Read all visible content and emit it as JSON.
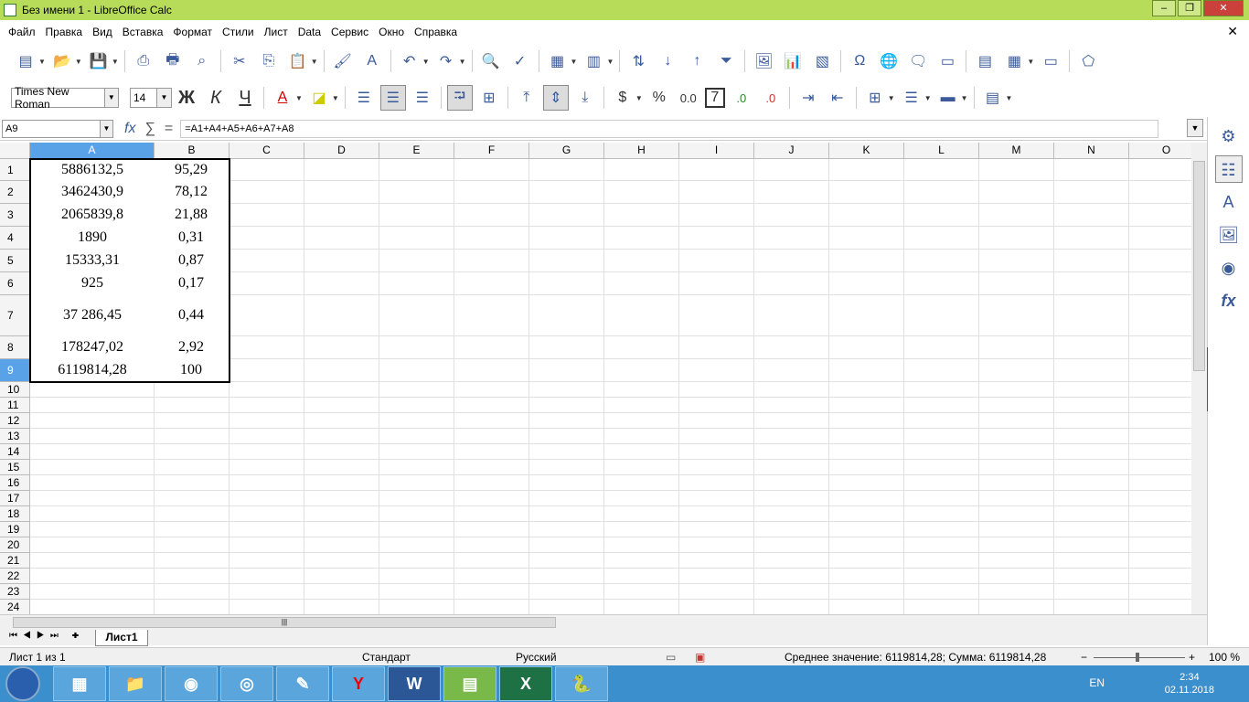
{
  "window": {
    "title": "Без имени 1 - LibreOffice Calc",
    "min": "–",
    "max": "❐",
    "close": "✕"
  },
  "menu": [
    "Файл",
    "Правка",
    "Вид",
    "Вставка",
    "Формат",
    "Стили",
    "Лист",
    "Data",
    "Сервис",
    "Окно",
    "Справка"
  ],
  "menu_close": "✕",
  "format": {
    "font": "Times New Roman",
    "size": "14",
    "bold": "Ж",
    "italic": "К",
    "underline": "Ч",
    "currency": "$",
    "percent": "%",
    "number": "0.0",
    "decimal_add": ".0",
    "decimal_remove": ".0"
  },
  "formula_bar": {
    "cell_ref": "A9",
    "fx": "fx",
    "sigma": "∑",
    "equals": "=",
    "formula": "=A1+A4+A5+A6+A7+A8"
  },
  "columns": [
    "A",
    "B",
    "C",
    "D",
    "E",
    "F",
    "G",
    "H",
    "I",
    "J",
    "K",
    "L",
    "M",
    "N",
    "O"
  ],
  "rows": [
    "1",
    "2",
    "3",
    "4",
    "5",
    "6",
    "7",
    "8",
    "9",
    "10",
    "11",
    "12",
    "13",
    "14",
    "15",
    "16",
    "17",
    "18",
    "19",
    "20",
    "21",
    "22",
    "23",
    "24"
  ],
  "table": [
    [
      "5886132,5",
      "95,29"
    ],
    [
      "3462430,9",
      "78,12"
    ],
    [
      "2065839,8",
      "21,88"
    ],
    [
      "1890",
      "0,31"
    ],
    [
      "15333,31",
      "0,87"
    ],
    [
      "925",
      "0,17"
    ],
    [
      "37 286,45",
      "0,44"
    ],
    [
      "178247,02",
      "2,92"
    ],
    [
      "6119814,28",
      "100"
    ]
  ],
  "sheet_tab": "Лист1",
  "status": {
    "sheet": "Лист 1 из 1",
    "style": "Стандарт",
    "lang": "Русский",
    "summary": "Среднее значение: 6119814,28; Сумма: 6119814,28",
    "zoom": "100 %",
    "minus": "−",
    "plus": "+"
  },
  "taskbar": {
    "lang": "EN",
    "time": "2:34",
    "date": "02.11.2018"
  },
  "colors": {
    "title": "#b7dc5a",
    "selection": "#5aa2e8",
    "taskbar": "#3b8fcc"
  }
}
